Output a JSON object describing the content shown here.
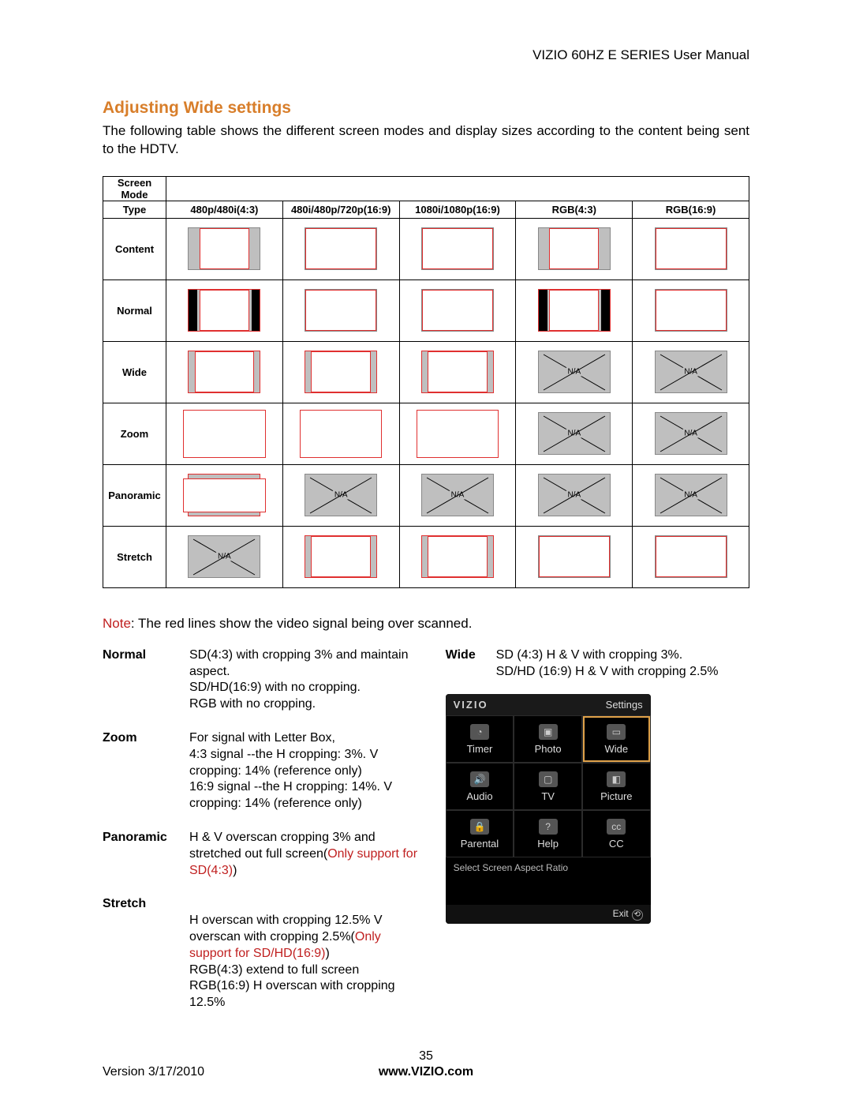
{
  "header": {
    "manual_title": "VIZIO 60HZ E SERIES User Manual"
  },
  "section": {
    "title": "Adjusting Wide settings",
    "intro": "The following table shows the different screen modes and display sizes according to the content being sent to the HDTV."
  },
  "table": {
    "screen_mode_header": "Screen Mode",
    "type_header": "Type",
    "columns": [
      "480p/480i(4:3)",
      "480i/480p/720p(16:9)",
      "1080i/1080p(16:9)",
      "RGB(4:3)",
      "RGB(16:9)"
    ],
    "row_labels": [
      "Content",
      "Normal",
      "Wide",
      "Zoom",
      "Panoramic",
      "Stretch"
    ],
    "na_label": "N/A"
  },
  "note": {
    "label": "Note",
    "text": ": The red lines show the video signal being over scanned."
  },
  "descriptions": {
    "left": [
      {
        "label": "Normal",
        "text_plain": "SD(4:3) with cropping 3% and maintain aspect.\nSD/HD(16:9) with no cropping.\nRGB with no cropping."
      },
      {
        "label": "Zoom",
        "text_plain": "For signal with Letter Box,\n4:3 signal --the H cropping: 3%. V cropping: 14% (reference only)\n16:9 signal --the H cropping: 14%. V cropping: 14% (reference only)"
      },
      {
        "label": "Panoramic",
        "text_before": "H & V overscan cropping 3% and stretched out full screen(",
        "red": "Only support for SD(4:3)",
        "text_after": ")"
      },
      {
        "label": "Stretch",
        "text_before": "H overscan with cropping 12.5% V overscan with cropping 2.5%(",
        "red": "Only support for SD/HD(16:9)",
        "text_after": ")\nRGB(4:3) extend to full screen\nRGB(16:9) H overscan with cropping 12.5%"
      }
    ],
    "right": {
      "label": "Wide",
      "text": "SD (4:3) H & V with cropping 3%.\nSD/HD (16:9) H & V with cropping 2.5%"
    }
  },
  "osd": {
    "logo": "VIZIO",
    "settings": "Settings",
    "items": [
      {
        "label": "Timer",
        "icon": "clock-icon"
      },
      {
        "label": "Photo",
        "icon": "photo-icon"
      },
      {
        "label": "Wide",
        "icon": "wide-icon",
        "highlight": true
      },
      {
        "label": "Audio",
        "icon": "speaker-icon"
      },
      {
        "label": "TV",
        "icon": "tv-icon"
      },
      {
        "label": "Picture",
        "icon": "picture-icon"
      },
      {
        "label": "Parental",
        "icon": "lock-icon"
      },
      {
        "label": "Help",
        "icon": "help-icon"
      },
      {
        "label": "CC",
        "icon": "cc-icon"
      }
    ],
    "status": "Select Screen Aspect Ratio",
    "exit": "Exit"
  },
  "footer": {
    "page_number": "35",
    "version": "Version 3/17/2010",
    "site": "www.VIZIO.com"
  }
}
